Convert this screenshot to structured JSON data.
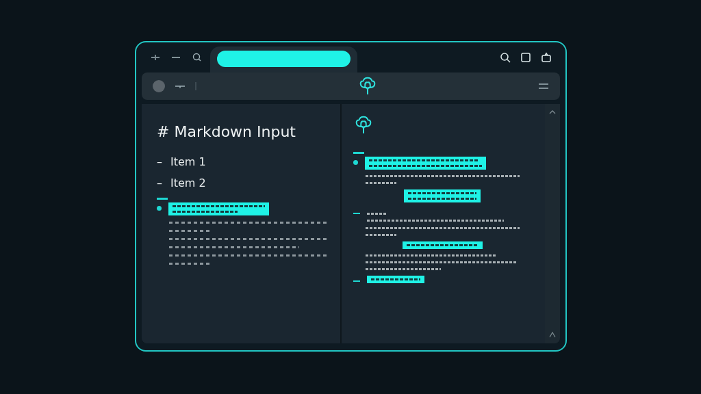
{
  "tabs": [
    {
      "selected": true
    }
  ],
  "editor": {
    "heading": "# Markdown Input",
    "items": [
      {
        "marker": "–",
        "text": "Item 1"
      },
      {
        "marker": "–",
        "text": "Item 2"
      }
    ],
    "blocks": [
      {
        "kind": "rule"
      },
      {
        "kind": "marked-highlight"
      },
      {
        "kind": "paragraph"
      },
      {
        "kind": "paragraph"
      },
      {
        "kind": "paragraph"
      }
    ]
  },
  "preview": {
    "blocks": [
      {
        "kind": "rule"
      },
      {
        "kind": "marked-highlight"
      },
      {
        "kind": "paragraph"
      },
      {
        "kind": "centered-highlight"
      },
      {
        "kind": "bulleted-paragraph"
      },
      {
        "kind": "paragraph"
      },
      {
        "kind": "centered-note"
      },
      {
        "kind": "paragraph"
      },
      {
        "kind": "bulleted-note"
      }
    ]
  }
}
